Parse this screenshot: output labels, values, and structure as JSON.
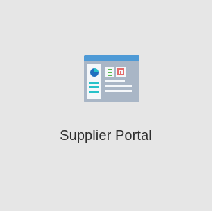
{
  "tile": {
    "label": "Supplier Portal",
    "icon": "dashboard-portal-icon"
  },
  "colors": {
    "tile_background": "#e6e6e6",
    "window_frame": "#a9b6c6",
    "title_bar": "#4e9ad6",
    "content_panel": "#f4f7fa",
    "pie_blue": "#1f6fbf",
    "pie_teal": "#26c1c9",
    "list_teal": "#26c1c9",
    "card_green": "#57b950",
    "card_red": "#e46a6a",
    "text_line": "#c7d1dc"
  }
}
